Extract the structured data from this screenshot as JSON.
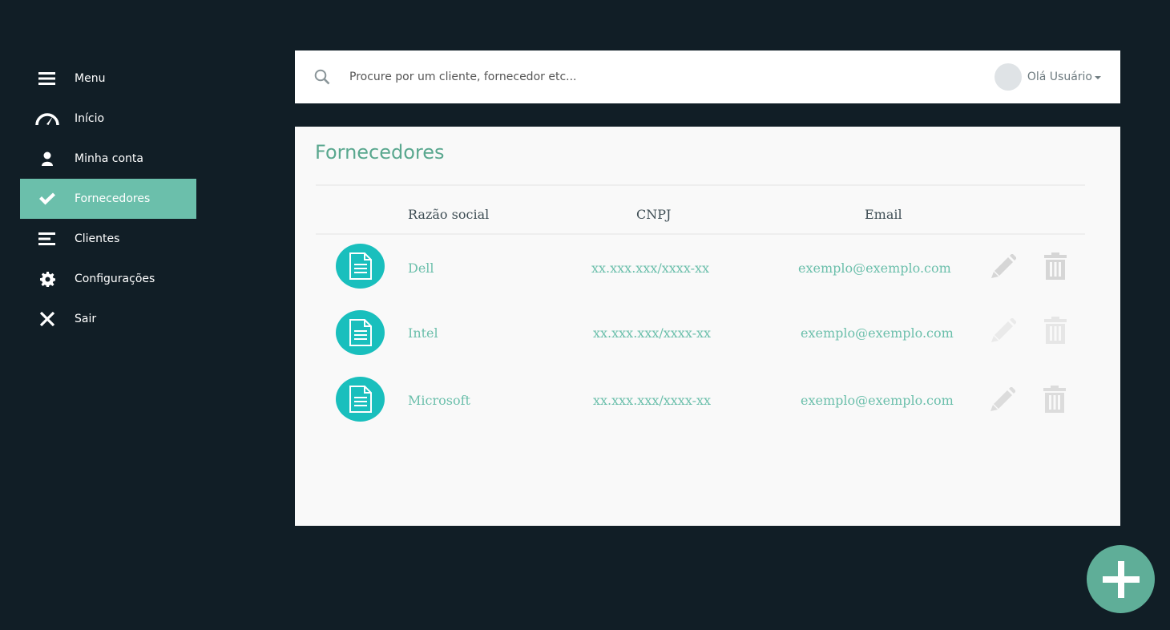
{
  "sidebar": {
    "items": [
      {
        "label": "Menu",
        "icon": "hamburger-icon"
      },
      {
        "label": "Início",
        "icon": "speedometer-icon"
      },
      {
        "label": "Minha conta",
        "icon": "user-icon"
      },
      {
        "label": "Fornecedores",
        "icon": "check-icon",
        "active": true
      },
      {
        "label": "Clientes",
        "icon": "list-lines-icon"
      },
      {
        "label": "Configurações",
        "icon": "gear-icon"
      },
      {
        "label": "Sair",
        "icon": "close-icon"
      }
    ]
  },
  "topbar": {
    "search_placeholder": "Procure por um cliente, fornecedor etc...",
    "user_greeting": "Olá Usuário"
  },
  "panel": {
    "title": "Fornecedores",
    "columns": [
      "Razão social",
      "CNPJ",
      "Email"
    ],
    "rows": [
      {
        "razao_social": "Dell",
        "cnpj": "xx.xxx.xxx/xxxx-xx",
        "email": "exemplo@exemplo.com"
      },
      {
        "razao_social": "Intel",
        "cnpj": "xx.xxx.xxx/xxxx-xx",
        "email": "exemplo@exemplo.com"
      },
      {
        "razao_social": "Microsoft",
        "cnpj": "xx.xxx.xxx/xxxx-xx",
        "email": "exemplo@exemplo.com"
      }
    ]
  },
  "colors": {
    "background": "#111e26",
    "accent": "#6bbfab",
    "title": "#5aa88f",
    "doc_icon_bg": "#19bfbd",
    "fab": "#5fae98"
  }
}
